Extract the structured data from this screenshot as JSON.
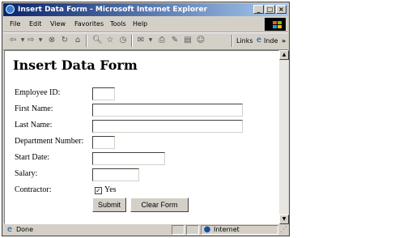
{
  "window": {
    "title": "Insert Data Form - Microsoft Internet Explorer"
  },
  "menu": {
    "file": "File",
    "edit": "Edit",
    "view": "View",
    "favorites": "Favorites",
    "tools": "Tools",
    "help": "Help"
  },
  "toolbar": {
    "links": "Links",
    "inde": "Inde",
    "more": "»"
  },
  "page": {
    "title": "Insert Data Form",
    "labels": {
      "employee_id": "Employee ID:",
      "first_name": "First Name:",
      "last_name": "Last Name:",
      "department_number": "Department Number:",
      "start_date": "Start Date:",
      "salary": "Salary:",
      "contractor": "Contractor:"
    },
    "contractor_checked": true,
    "contractor_option": "Yes",
    "buttons": {
      "submit": "Submit",
      "clear": "Clear Form"
    }
  },
  "status": {
    "text": "Done",
    "zone": "Internet"
  },
  "colors": {
    "titlebar_start": "#0a246a",
    "titlebar_end": "#a6caf0",
    "chrome": "#d4d0c8"
  }
}
